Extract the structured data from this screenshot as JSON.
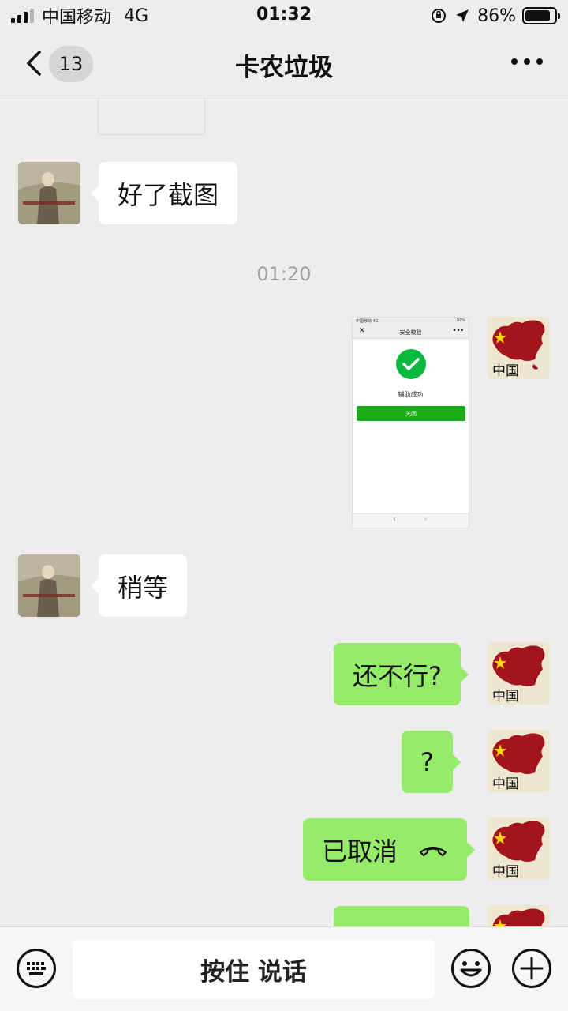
{
  "status_bar": {
    "carrier": "中国移动",
    "network": "4G",
    "time": "01:32",
    "battery_percent": "86%",
    "battery_level": 0.86
  },
  "nav": {
    "back_icon": "chevron-left-icon",
    "unread_count": "13",
    "title": "卡农垃圾",
    "more_icon": "more-icon"
  },
  "messages": {
    "m1": {
      "text": "好了截图"
    },
    "timestamp": "01:20",
    "image": {
      "nav_title": "安全校验",
      "status_carrier": "中国移动 4G",
      "status_battery": "97%",
      "label": "辅助成功",
      "button": "关闭",
      "prev": "‹",
      "next": "›"
    },
    "m2": {
      "text": "稍等"
    },
    "m3": {
      "text": "还不行?"
    },
    "m4": {
      "text": "?"
    },
    "m5": {
      "text": "已取消",
      "icon": "hangup-icon"
    }
  },
  "input_bar": {
    "keyboard_icon": "keyboard-icon",
    "voice_label": "按住 说话",
    "emoji_icon": "emoji-icon",
    "plus_icon": "plus-icon"
  },
  "colors": {
    "background": "#ededed",
    "outgoing_bubble": "#95ec69",
    "incoming_bubble": "#ffffff",
    "timestamp": "#a3a3a3"
  }
}
